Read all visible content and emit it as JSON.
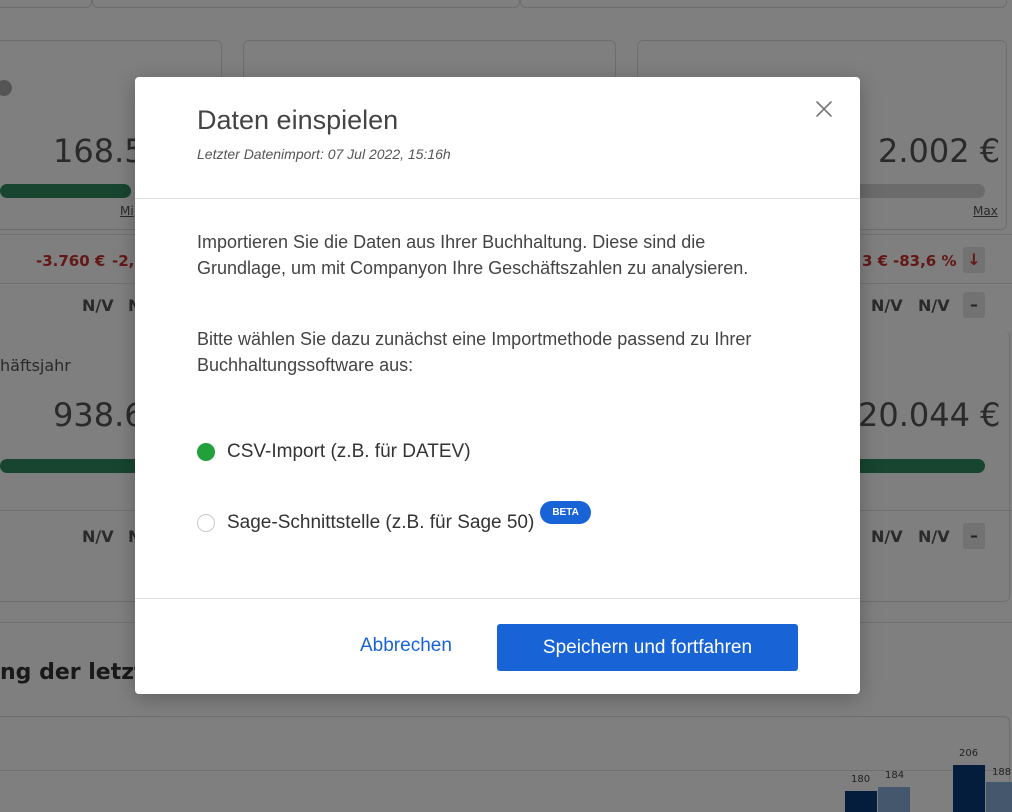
{
  "background": {
    "card1_value": "168.5",
    "card1_min_label": "Mi",
    "card3_value": "2.002 €",
    "card3_max_label": "Max",
    "row1_neg_a": "-3.760 €",
    "row1_neg_b": "-2,",
    "row1_right_neg_a": "3 €",
    "row1_right_neg_b": "-83,6 %",
    "down_arrow": "↓",
    "nv": "N/V",
    "nv_partial": "N",
    "dash": "–",
    "geschaeftsjahr": "häftsjahr",
    "card4_value": "938.6",
    "card5_value": "20.044 €",
    "section_title": "ng der letzt",
    "chart_labels": [
      "180",
      "184",
      "206",
      "188"
    ]
  },
  "dialog": {
    "title": "Daten einspielen",
    "subtitle": "Letzter Datenimport: 07 Jul 2022, 15:16h",
    "paragraph1": "Importieren Sie die Daten aus Ihrer Buchhaltung. Diese sind die Grundlage, um mit Companyon Ihre Geschäftszahlen zu analysieren.",
    "paragraph2": "Bitte wählen Sie dazu zunächst eine Importmethode passend zu Ihrer Buchhaltungssoftware aus:",
    "options": [
      {
        "label": "CSV-Import (z.B. für DATEV)",
        "selected": true
      },
      {
        "label": "Sage-Schnittstelle (z.B. für Sage 50)",
        "selected": false,
        "badge": "BETA"
      }
    ],
    "cancel_label": "Abbrechen",
    "primary_label": "Speichern und fortfahren",
    "close_icon": "close-icon"
  },
  "colors": {
    "primary": "#1864d6",
    "radio_selected": "#22a13a",
    "progress_green": "#2f8a5f",
    "negative_red": "#c8302c"
  }
}
